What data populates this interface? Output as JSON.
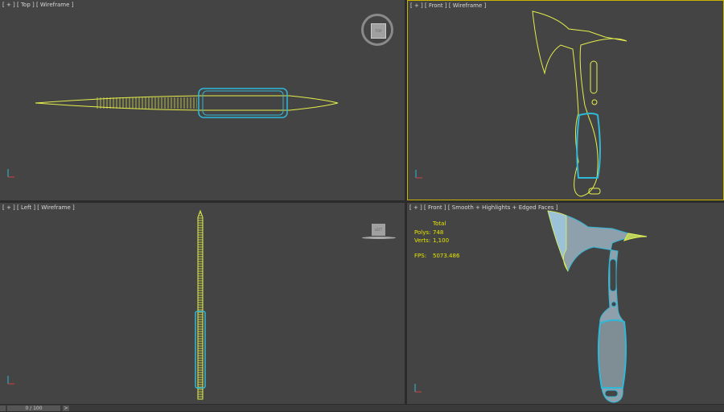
{
  "viewports": {
    "top": {
      "label": "[ + ] [ Top ] [ Wireframe ]",
      "viewcube": "TOP"
    },
    "front_wire": {
      "label": "[ + ] [ Front ] [ Wireframe ]",
      "active": true
    },
    "left": {
      "label": "[ + ] [ Left ] [ Wireframe ]",
      "viewcube": "LEFT"
    },
    "front_shaded": {
      "label": "[ + ] [ Front ] [ Smooth + Highlights + Edged Faces ]"
    }
  },
  "stats": {
    "header": "Total",
    "polys_label": "Polys:",
    "polys": "748",
    "verts_label": "Verts:",
    "verts": "1,100",
    "fps_label": "FPS:",
    "fps": "5073.486"
  },
  "timeline": {
    "frame": "0 / 100",
    "next": ">"
  },
  "colors": {
    "wire_yellow": "#e6ef4a",
    "wire_cyan": "#2fb8d8",
    "active_border": "#c8b400",
    "viewport_bg": "#444444"
  }
}
